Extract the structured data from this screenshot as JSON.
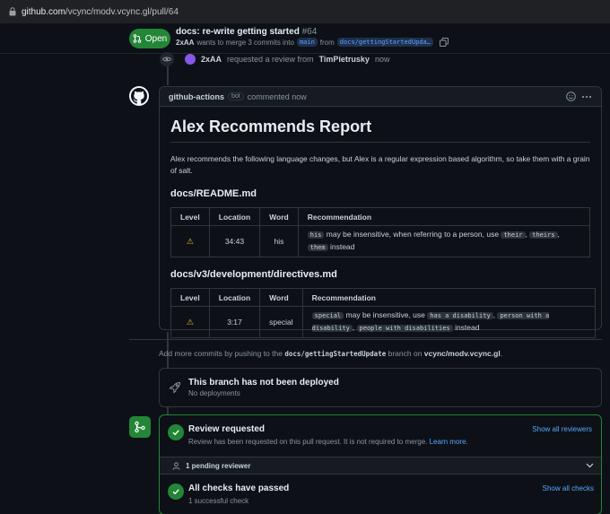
{
  "browser": {
    "url_host": "github.com",
    "url_path": "/vcync/modv.vcync.gl/pull/64"
  },
  "pr": {
    "state": "Open",
    "title": "docs: re-write getting started",
    "number": "#64",
    "author": "2xAA",
    "merge_text_1": "wants to merge 3 commits into",
    "base_branch": "main",
    "merge_text_2": "from",
    "head_branch": "docs/gettingStartedUpda…"
  },
  "review_event": {
    "actor": "2xAA",
    "text": "requested a review from",
    "reviewer": "TimPietrusky",
    "time": "now"
  },
  "comment": {
    "author": "github-actions",
    "badge": "bot",
    "meta": "commented now",
    "report_title": "Alex Recommends Report",
    "intro": "Alex recommends the following language changes, but Alex is a regular expression based algorithm, so take them with a grain of salt.",
    "headers": [
      "Level",
      "Location",
      "Word",
      "Recommendation"
    ],
    "sections": [
      {
        "file": "docs/README.md",
        "location": "34:43",
        "word": "his",
        "rec_code": "his",
        "rec_text": "may be insensitive, when referring to a person, use",
        "alts": [
          "their",
          "theirs",
          "them"
        ],
        "rec_tail": "instead"
      },
      {
        "file": "docs/v3/development/directives.md",
        "location": "3:17",
        "word": "special",
        "rec_code": "special",
        "rec_text": "may be insensitive, use",
        "alts": [
          "has a disability",
          "person with a disability",
          "people with disabilities"
        ],
        "rec_tail": "instead"
      }
    ]
  },
  "push_note": {
    "pre": "Add more commits by pushing to the",
    "branch": "docs/gettingStartedUpdate",
    "mid": "branch on",
    "repo": "vcync/modv.vcync.gl",
    "post": "."
  },
  "deploy": {
    "title": "This branch has not been deployed",
    "sub": "No deployments"
  },
  "review": {
    "title": "Review requested",
    "sub": "Review has been requested on this pull request. It is not required to merge.",
    "learn_more": "Learn more.",
    "link": "Show all reviewers",
    "pending": "1 pending reviewer"
  },
  "checks": {
    "title": "All checks have passed",
    "sub": "1 successful check",
    "link": "Show all checks"
  },
  "colors": {
    "accent": "#58a6ff",
    "success": "#238636",
    "background": "#0d1117",
    "border": "#30363d"
  }
}
